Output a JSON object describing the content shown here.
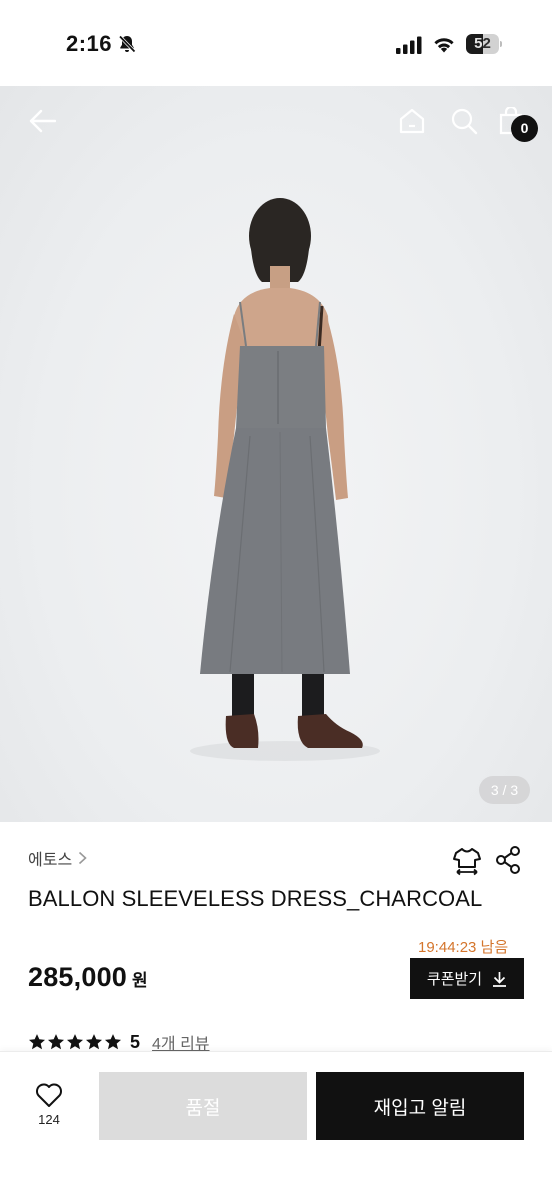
{
  "status_bar": {
    "time": "2:16",
    "battery": "52",
    "battery_level": 0.52
  },
  "gallery": {
    "page_indicator": "3 / 3",
    "cart_count": "0"
  },
  "product": {
    "brand": "에토스",
    "title": "BALLON SLEEVELESS DRESS_CHARCOAL",
    "timer": "19:44:23 남음",
    "price": "285,000",
    "price_unit": "원",
    "coupon_label": "쿠폰받기",
    "rating": "5",
    "stars": 5,
    "review_link": "4개 리뷰"
  },
  "bottom_bar": {
    "wish_count": "124",
    "soldout_label": "품절",
    "restock_label": "재입고 알림"
  },
  "colors": {
    "accent_timer": "#d4752c",
    "primary_button": "#111111",
    "disabled_button": "#dcdcdc"
  }
}
